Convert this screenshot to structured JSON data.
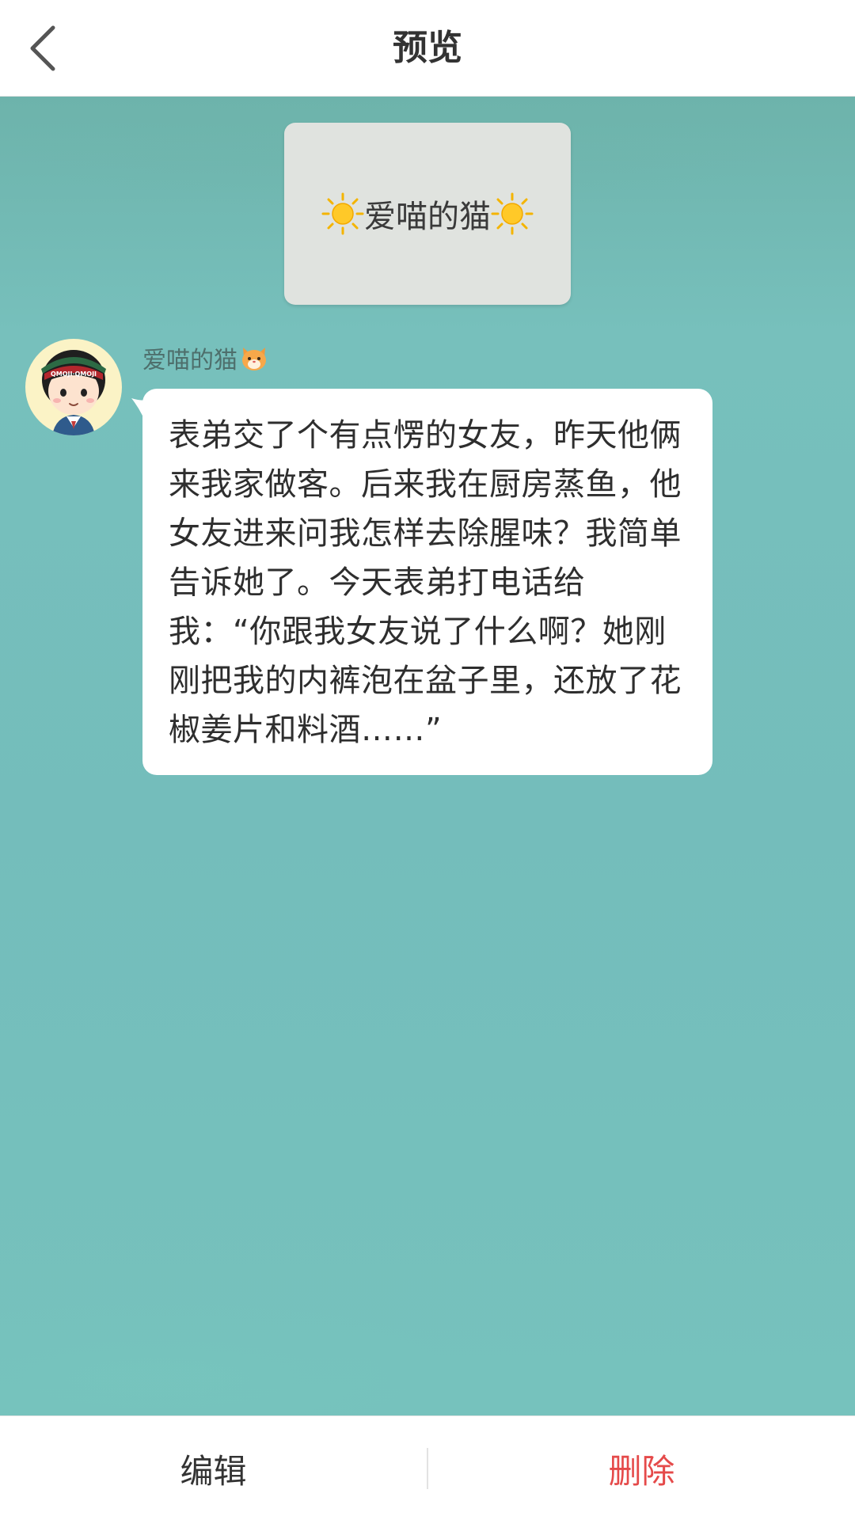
{
  "header": {
    "back_icon": "chevron-left-icon",
    "title": "预览"
  },
  "name_card": {
    "text": "爱喵的猫",
    "leading_icon": "sun-icon",
    "trailing_icon": "sun-icon"
  },
  "message": {
    "avatar": "cartoon-avatar",
    "avatar_cap_text": "QMOJI·QMOJI",
    "sender_name": "爱喵的猫",
    "sender_name_icon": "cat-face-icon",
    "text": "表弟交了个有点愣的女友，昨天他俩来我家做客。后来我在厨房蒸鱼，他女友进来问我怎样去除腥味？我简单告诉她了。今天表弟打电话给我：“你跟我女友说了什么啊？她刚刚把我的内裤泡在盆子里，还放了花椒姜片和料酒……”"
  },
  "footer": {
    "edit_label": "编辑",
    "delete_label": "删除"
  },
  "colors": {
    "background_teal": "#75bebb",
    "delete_red": "#e54a4a",
    "title_text": "#333333"
  }
}
